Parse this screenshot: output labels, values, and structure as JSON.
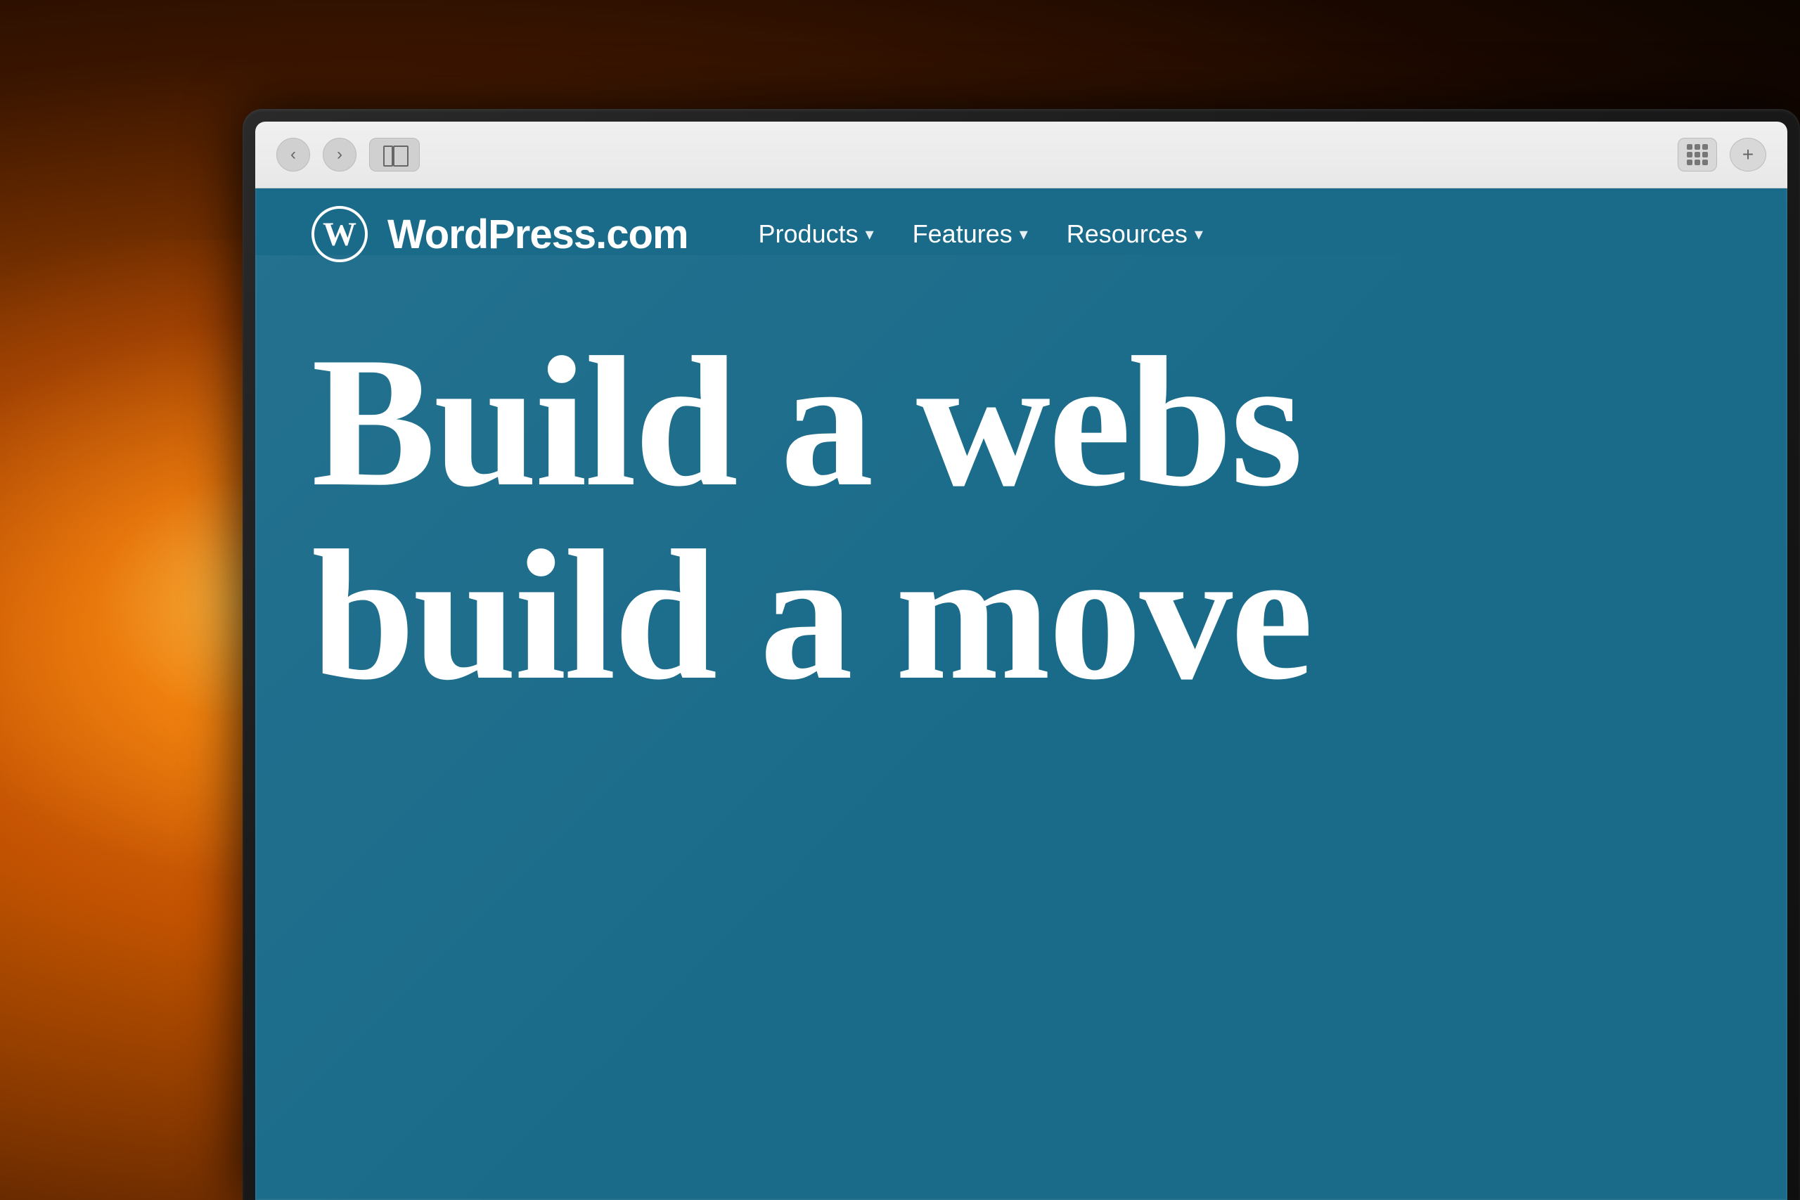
{
  "background": {
    "description": "Warm bokeh background with orange/amber light"
  },
  "browser": {
    "back_button_label": "‹",
    "forward_button_label": "›",
    "grid_button_label": "grid",
    "new_tab_button_label": "+"
  },
  "website": {
    "logo_icon": "W",
    "logo_text": "WordPress.com",
    "nav": {
      "items": [
        {
          "label": "Products",
          "has_dropdown": true
        },
        {
          "label": "Features",
          "has_dropdown": true
        },
        {
          "label": "Resources",
          "has_dropdown": true
        }
      ]
    },
    "hero": {
      "line1": "Build a webs",
      "line2": "build a move"
    },
    "bg_color": "#1a6b8a"
  }
}
